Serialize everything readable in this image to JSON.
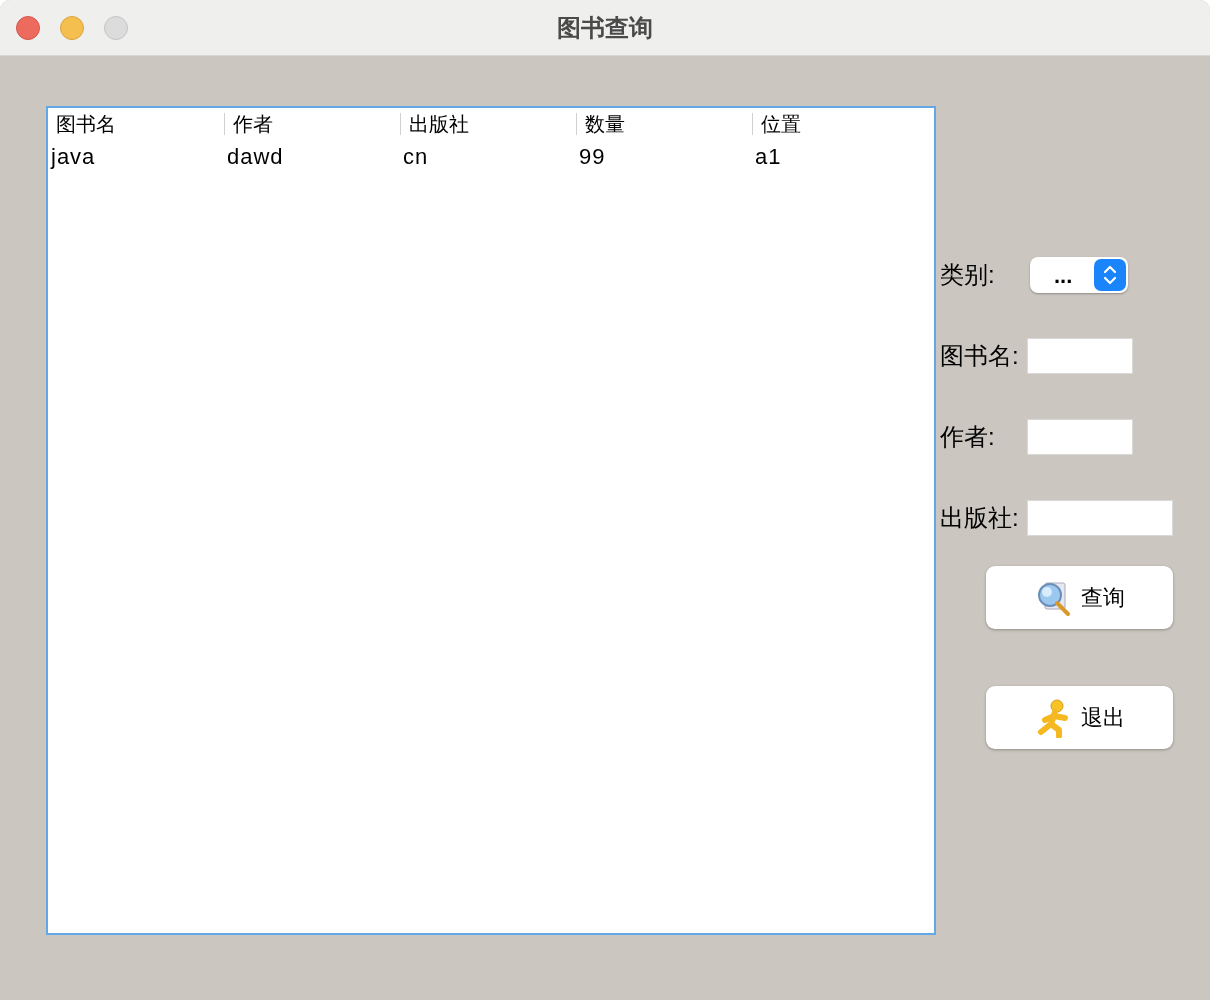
{
  "window": {
    "title": "图书查询"
  },
  "table": {
    "columns": [
      "图书名",
      "作者",
      "出版社",
      "数量",
      "位置"
    ],
    "rows": [
      [
        "java",
        "dawd",
        "cn",
        "99",
        "a1"
      ]
    ]
  },
  "form": [
    {
      "kind": "select",
      "label": "类别:",
      "value": "..."
    },
    {
      "kind": "text",
      "label": "图书名:"
    },
    {
      "kind": "text",
      "label": "作者:"
    },
    {
      "kind": "text",
      "label": "出版社:"
    }
  ],
  "buttons": [
    {
      "kind": "search",
      "label": "查询"
    },
    {
      "kind": "exit",
      "label": "退出"
    }
  ]
}
